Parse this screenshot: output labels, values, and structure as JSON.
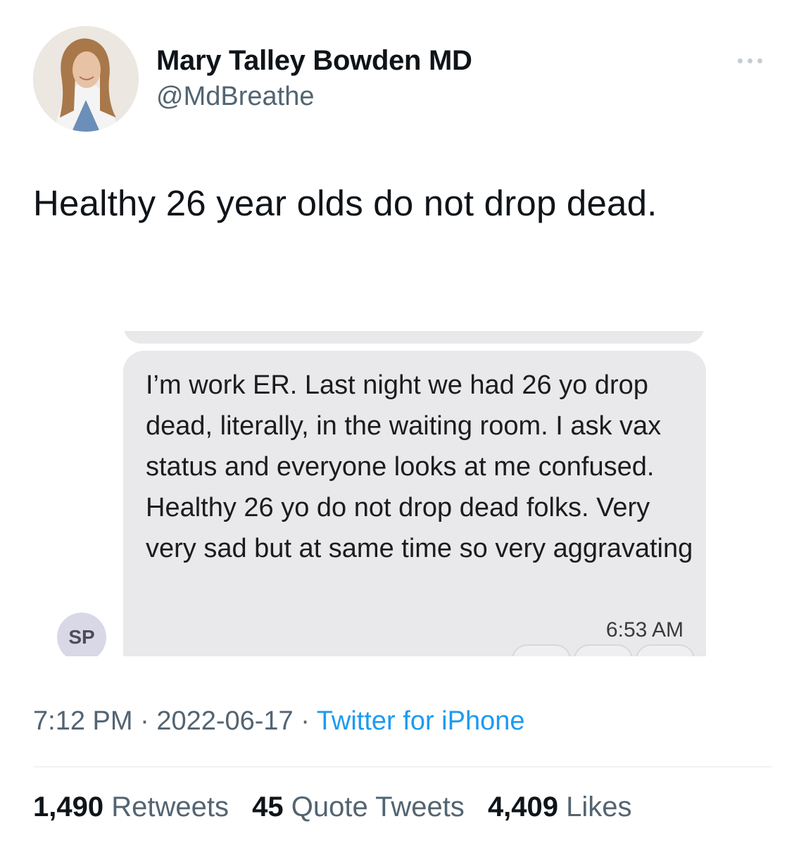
{
  "author": {
    "display_name": "Mary Talley Bowden MD",
    "handle": "@MdBreathe",
    "avatar_icon": "profile-photo"
  },
  "tweet": {
    "text": "Healthy 26 year olds do not drop dead."
  },
  "embedded_screenshot": {
    "message": "I’m work ER. Last night we had 26 yo drop dead, literally, in the waiting room. I ask vax status and everyone looks at me confused. Healthy 26 yo do not drop dead folks. Very very sad but at same time so very aggravating",
    "time": "6:53 AM",
    "sender_initials": "SP",
    "bubble_color": "#e9e9eb"
  },
  "meta": {
    "time": "7:12 PM",
    "separator": "·",
    "date": "2022-06-17",
    "source": "Twitter for iPhone",
    "source_color": "#1d9bf0"
  },
  "stats": {
    "retweets_count": "1,490",
    "retweets_label": "Retweets",
    "quotes_count": "45",
    "quotes_label": "Quote Tweets",
    "likes_count": "4,409",
    "likes_label": "Likes"
  }
}
